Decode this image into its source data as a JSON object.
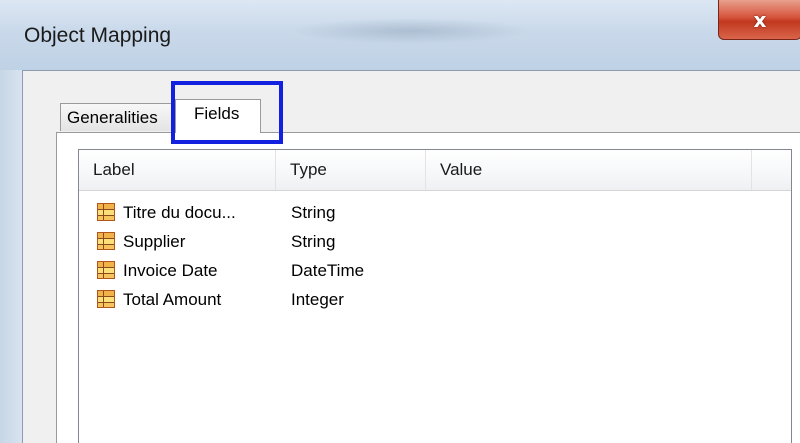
{
  "window": {
    "title": "Object Mapping",
    "close_glyph": "x",
    "close_icon": "close-icon"
  },
  "tabs": [
    {
      "label": "Generalities",
      "selected": false
    },
    {
      "label": "Fields",
      "selected": true
    }
  ],
  "highlight_color": "#1221e0",
  "list": {
    "columns": [
      "Label",
      "Type",
      "Value"
    ],
    "row_icon": "field-icon",
    "rows": [
      {
        "label": "Titre du docu...",
        "type": "String",
        "value": ""
      },
      {
        "label": "Supplier",
        "type": "String",
        "value": ""
      },
      {
        "label": "Invoice Date",
        "type": "DateTime",
        "value": ""
      },
      {
        "label": "Total Amount",
        "type": "Integer",
        "value": ""
      }
    ]
  }
}
